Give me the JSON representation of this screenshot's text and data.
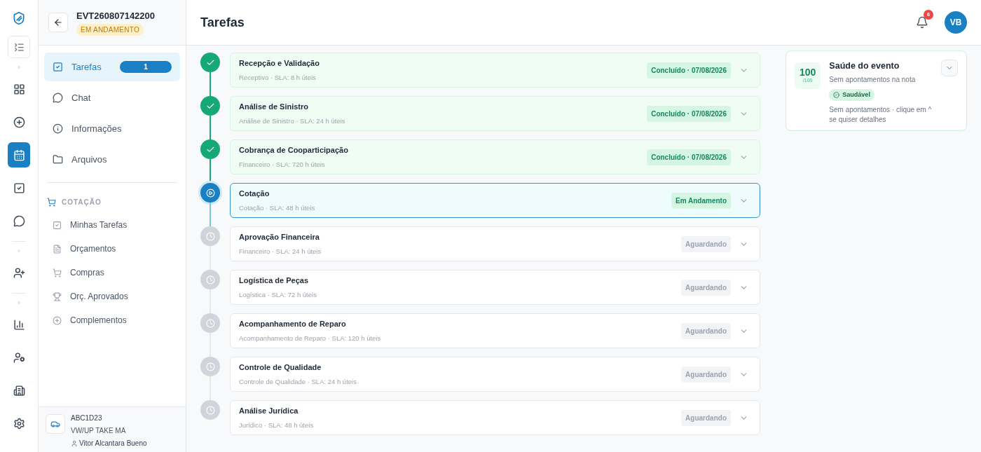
{
  "event": {
    "code": "EVT260807142200",
    "status": "EM ANDAMENTO"
  },
  "nav": [
    {
      "label": "Tarefas",
      "kind": "tasks",
      "selected": true,
      "badge": "1"
    },
    {
      "label": "Chat",
      "kind": "chat",
      "selected": false
    },
    {
      "label": "Informações",
      "kind": "info",
      "selected": false
    },
    {
      "label": "Arquivos",
      "kind": "folder",
      "selected": false
    }
  ],
  "section": {
    "title": "COTAÇÃO",
    "items": [
      {
        "label": "Minhas Tarefas",
        "kind": "tasks"
      },
      {
        "label": "Orçamentos",
        "kind": "doc"
      },
      {
        "label": "Compras",
        "kind": "cart"
      },
      {
        "label": "Orç. Aprovados",
        "kind": "trophy"
      },
      {
        "label": "Complementos",
        "kind": "plus"
      }
    ]
  },
  "vehicle": {
    "plate": "ABC1D23",
    "model": "VW/UP TAKE MA",
    "owner": "Vitor Alcantara Bueno"
  },
  "rail": [
    {
      "kind": "grid",
      "selected": false
    },
    {
      "kind": "plus",
      "selected": false
    },
    {
      "kind": "calendar",
      "selected": true
    },
    {
      "kind": "check",
      "selected": false
    },
    {
      "kind": "chat",
      "selected": false
    },
    {
      "kind": "user-plus",
      "selected": false
    },
    {
      "kind": "chart",
      "selected": false
    },
    {
      "kind": "user-gear",
      "selected": false
    },
    {
      "kind": "building",
      "selected": false
    },
    {
      "kind": "settings",
      "selected": false
    }
  ],
  "page_title": "Tarefas",
  "notifications": "6",
  "avatar": "VB",
  "tasks": [
    {
      "title": "Recepção e Validação",
      "subtitle": "Receptivo · SLA: 8 h úteis",
      "status": "Concluído · 07/08/2026",
      "kind": "done"
    },
    {
      "title": "Análise de Sinistro",
      "subtitle": "Análise de Sinistro · SLA: 24 h úteis",
      "status": "Concluído · 07/08/2026",
      "kind": "done"
    },
    {
      "title": "Cobrança de Cooparticipação",
      "subtitle": "Financeiro · SLA: 720 h úteis",
      "status": "Concluído · 07/08/2026",
      "kind": "done"
    },
    {
      "title": "Cotação",
      "subtitle": "Cotação · SLA: 48 h úteis",
      "status": "Em Andamento",
      "kind": "active"
    },
    {
      "title": "Aprovação Financeira",
      "subtitle": "Financeiro · SLA: 24 h úteis",
      "status": "Aguardando",
      "kind": "waiting"
    },
    {
      "title": "Logística de Peças",
      "subtitle": "Logística · SLA: 72 h úteis",
      "status": "Aguardando",
      "kind": "waiting"
    },
    {
      "title": "Acompanhamento de Reparo",
      "subtitle": "Acompanhamento de Reparo · SLA: 120 h úteis",
      "status": "Aguardando",
      "kind": "waiting"
    },
    {
      "title": "Controle de Qualidade",
      "subtitle": "Controle de Qualidade · SLA: 24 h úteis",
      "status": "Aguardando",
      "kind": "waiting"
    },
    {
      "title": "Análise Jurídica",
      "subtitle": "Jurídico · SLA: 48 h úteis",
      "status": "Aguardando",
      "kind": "waiting"
    }
  ],
  "health": {
    "score": "100",
    "max": "/100",
    "title": "Saúde do evento",
    "subtitle": "Sem apontamentos na nota",
    "badge": "Saudável",
    "note": "Sem apontamentos · clique em ^ se quiser detalhes"
  }
}
